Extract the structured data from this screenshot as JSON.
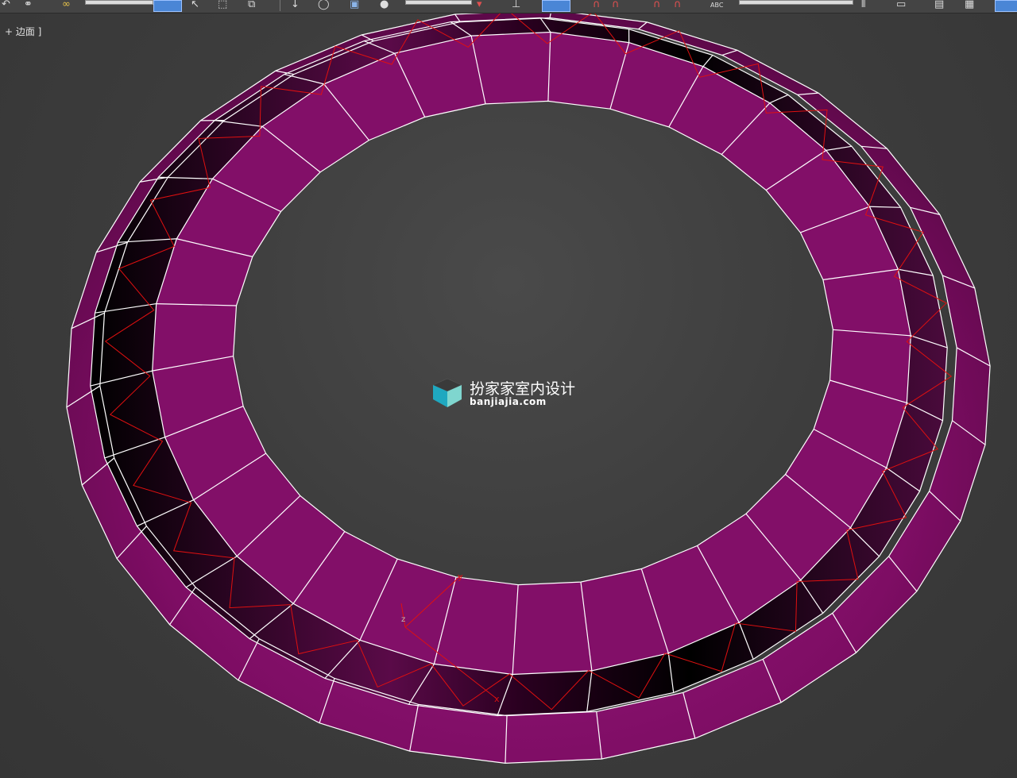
{
  "viewport": {
    "label": "+ 边面 ]",
    "background": "#3a3a3a",
    "object_color": "#8a0f6e",
    "wire_color": "#ffffff",
    "gizmo_color": "#e01010"
  },
  "gizmo": {
    "x_label": "x",
    "y_label": "y",
    "z_label": "z"
  },
  "watermark": {
    "title": "扮家家室内设计",
    "url": "banjiajia.com"
  },
  "toolbar": {
    "icons": [
      "undo-icon",
      "link-icon",
      "bind-icon",
      "select-icon",
      "select-move-icon",
      "region-select-icon",
      "window-crossing-icon",
      "move-icon",
      "rotate-icon",
      "scale-icon",
      "sphere-icon",
      "snap-icon",
      "mirror-icon",
      "align-icon",
      "spell-check-icon",
      "layer-icon",
      "curve-editor-icon",
      "render-icon"
    ],
    "abc_label": "ABC"
  }
}
